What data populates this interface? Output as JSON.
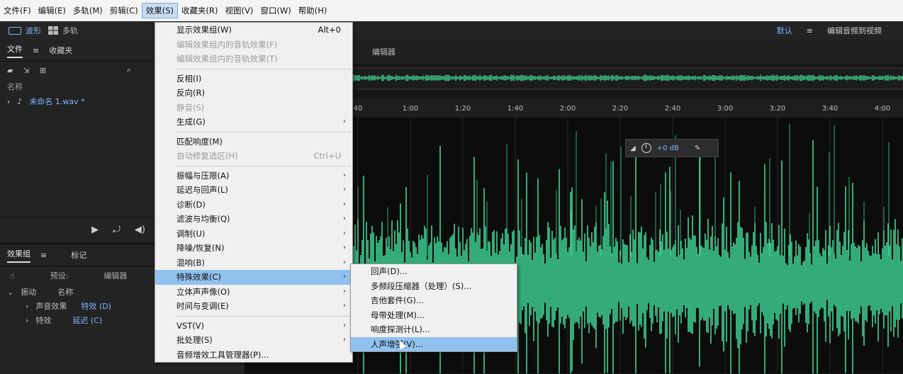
{
  "menubar": {
    "items": [
      "文件(F)",
      "编辑(E)",
      "多轨(M)",
      "剪辑(C)",
      "效果(S)",
      "收藏夹(R)",
      "视图(V)",
      "窗口(W)",
      "帮助(H)"
    ]
  },
  "workspace": {
    "waveform_button": "波形",
    "multitrack_button": "多轨"
  },
  "topright": {
    "default_label": "默认",
    "edit_label": "编辑音频到视频"
  },
  "files_panel": {
    "tab_files": "文件",
    "tab_favorites": "收藏夹",
    "header_name": "名称",
    "file_name": "未命名 1.wav *"
  },
  "effects_panel": {
    "tab_effects_rack": "效果组",
    "tab_markers": "标记",
    "default_label": "默认",
    "preset_label": "预设:",
    "category_label": "编辑器",
    "col_name": "名称",
    "tree_items": [
      "振动",
      "声音效果",
      "特效 (D)",
      "延迟 (C)",
      "特效"
    ]
  },
  "editor": {
    "tab_label": "编辑器"
  },
  "timeline": {
    "ticks": [
      "40",
      "1:00",
      "1:20",
      "1:40",
      "2:00",
      "2:20",
      "2:40",
      "3:00",
      "3:20",
      "3:40",
      "4:00"
    ]
  },
  "hud": {
    "gain_value": "+0 dB"
  },
  "main_menu": {
    "items": [
      {
        "label": "显示效果组(W)",
        "shortcut": "Alt+0",
        "disabled": false
      },
      {
        "label": "编辑效果组内的音轨效果(F)",
        "disabled": true
      },
      {
        "label": "编辑效果组内的音轨效果(T)",
        "disabled": true
      },
      {
        "sep": true
      },
      {
        "label": "反相(I)",
        "disabled": false
      },
      {
        "label": "反向(R)",
        "disabled": false
      },
      {
        "label": "静音(S)",
        "disabled": true
      },
      {
        "label": "生成(G)",
        "submenu": true
      },
      {
        "sep": true
      },
      {
        "label": "匹配响度(M)",
        "disabled": false
      },
      {
        "label": "自动修复选区(H)",
        "shortcut": "Ctrl+U",
        "disabled": true
      },
      {
        "sep": true
      },
      {
        "label": "振幅与压限(A)",
        "submenu": true
      },
      {
        "label": "延迟与回声(L)",
        "submenu": true
      },
      {
        "label": "诊断(D)",
        "submenu": true
      },
      {
        "label": "滤波与均衡(Q)",
        "submenu": true
      },
      {
        "label": "调制(U)",
        "submenu": true
      },
      {
        "label": "降噪/恢复(N)",
        "submenu": true
      },
      {
        "label": "混响(B)",
        "submenu": true
      },
      {
        "label": "特殊效果(C)",
        "submenu": true,
        "highlight": true
      },
      {
        "label": "立体声声像(O)",
        "submenu": true
      },
      {
        "label": "时间与变调(E)",
        "submenu": true
      },
      {
        "sep": true
      },
      {
        "label": "VST(V)",
        "submenu": true
      },
      {
        "label": "批处理(S)",
        "submenu": true
      },
      {
        "label": "音频增效工具管理器(P)..."
      }
    ]
  },
  "sub_menu": {
    "items": [
      {
        "label": "回声(D)..."
      },
      {
        "label": "多频段压缩器（处理）(S)..."
      },
      {
        "label": "吉他套件(G)..."
      },
      {
        "label": "母带处理(M)..."
      },
      {
        "label": "响度探测计(L)..."
      },
      {
        "label": "人声增强(V)...",
        "highlight": true
      }
    ]
  },
  "colors": {
    "waveform": "#3fd495",
    "menu_bg": "#f0f0f0",
    "highlight": "#91c1ee",
    "accent": "#7fb4ff"
  }
}
